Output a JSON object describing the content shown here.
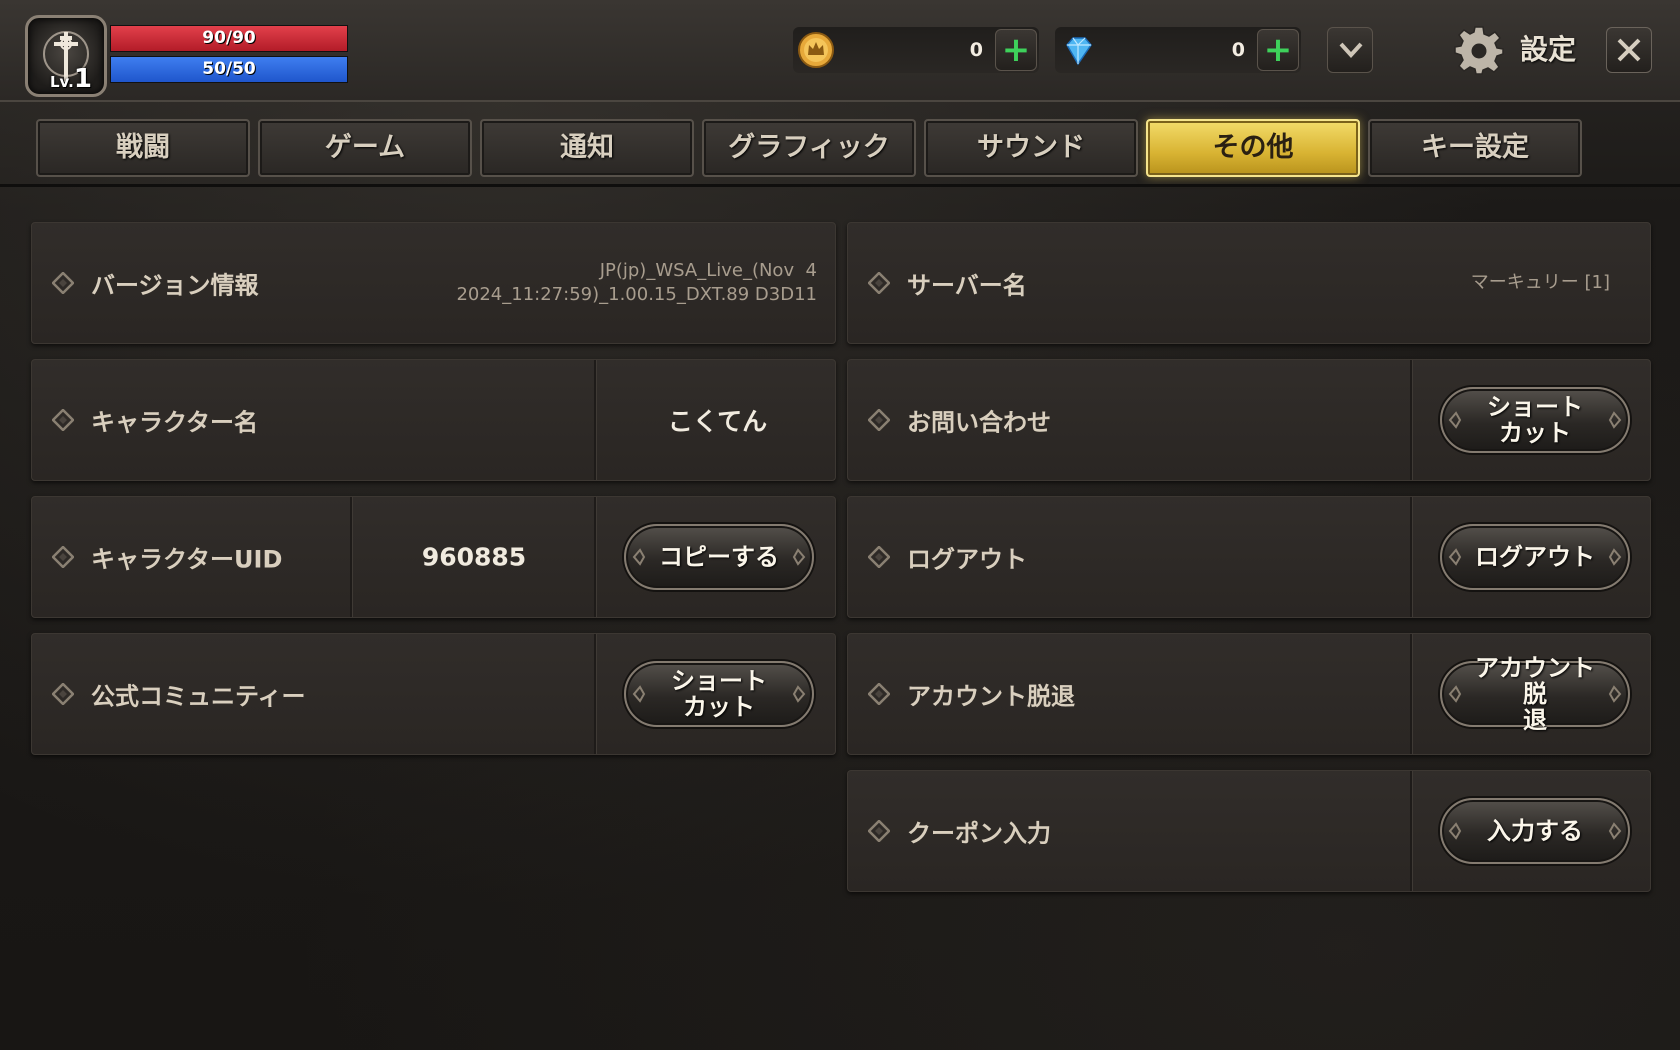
{
  "player": {
    "level_prefix": "Lv.",
    "level": "1",
    "hp": "90/90",
    "mp": "50/50"
  },
  "currency": {
    "gold": "0",
    "gems": "0"
  },
  "header": {
    "title": "設定"
  },
  "tabs": [
    {
      "label": "戦闘"
    },
    {
      "label": "ゲーム"
    },
    {
      "label": "通知"
    },
    {
      "label": "グラフィック"
    },
    {
      "label": "サウンド"
    },
    {
      "label": "その他"
    },
    {
      "label": "キー設定"
    }
  ],
  "active_tab": "その他",
  "left": {
    "version": {
      "label": "バージョン情報",
      "line1": "JP(jp)_WSA_Live_(Nov  4",
      "line2": "2024_11:27:59)_1.00.15_DXT.89 D3D11"
    },
    "character_name": {
      "label": "キャラクター名",
      "value": "こくてん"
    },
    "character_uid": {
      "label": "キャラクターUID",
      "value": "960885",
      "button": "コピーする"
    },
    "community": {
      "label": "公式コミュニティー",
      "button_line1": "ショート",
      "button_line2": "カット"
    }
  },
  "right": {
    "server": {
      "label": "サーバー名",
      "value": "マーキュリー [1]"
    },
    "contact": {
      "label": "お問い合わせ",
      "button_line1": "ショート",
      "button_line2": "カット"
    },
    "logout": {
      "label": "ログアウト",
      "button": "ログアウト"
    },
    "delete_account": {
      "label": "アカウント脱退",
      "button_line1": "アカウント脱",
      "button_line2": "退"
    },
    "coupon": {
      "label": "クーポン入力",
      "button": "入力する"
    }
  },
  "colors": {
    "hp": "#d22b37",
    "mp": "#2e6ae0",
    "active_tab": "#e6c54a",
    "plus": "#3ed15b"
  }
}
